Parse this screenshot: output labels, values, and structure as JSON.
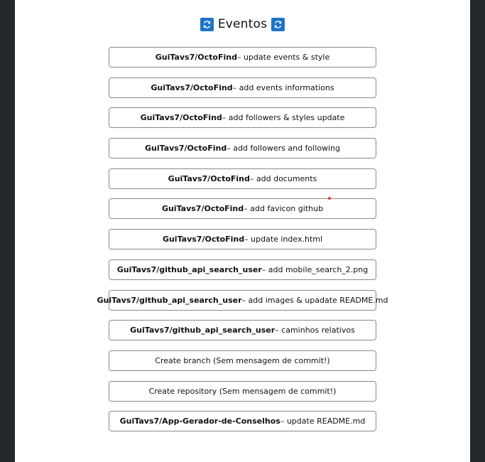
{
  "heading": {
    "title": "Eventos",
    "icon": "refresh-icon",
    "icon_color": "#1e73c9"
  },
  "events": [
    {
      "repo": "GuiTavs7/OctoFind",
      "message": " – update events & style"
    },
    {
      "repo": "GuiTavs7/OctoFind",
      "message": " – add events informations"
    },
    {
      "repo": "GuiTavs7/OctoFind",
      "message": " – add followers & styles update"
    },
    {
      "repo": "GuiTavs7/OctoFind",
      "message": " – add followers and following"
    },
    {
      "repo": "GuiTavs7/OctoFind",
      "message": " – add documents"
    },
    {
      "repo": "GuiTavs7/OctoFind",
      "message": " – add favicon github"
    },
    {
      "repo": "GuiTavs7/OctoFind",
      "message": " – update index.html"
    },
    {
      "repo": "GuiTavs7/github_api_search_user",
      "message": " – add mobile_search_2.png"
    },
    {
      "repo": "GuiTavs7/github_api_search_user",
      "message": " – add images & upadate README.md"
    },
    {
      "repo": "GuiTavs7/github_api_search_user",
      "message": " – caminhos relativos"
    },
    {
      "repo": "",
      "message": "Create branch (Sem mensagem de commit!)"
    },
    {
      "repo": "",
      "message": "Create repository (Sem mensagem de commit!)"
    },
    {
      "repo": "GuiTavs7/App-Gerador-de-Conselhos",
      "message": " – update README.md"
    }
  ]
}
